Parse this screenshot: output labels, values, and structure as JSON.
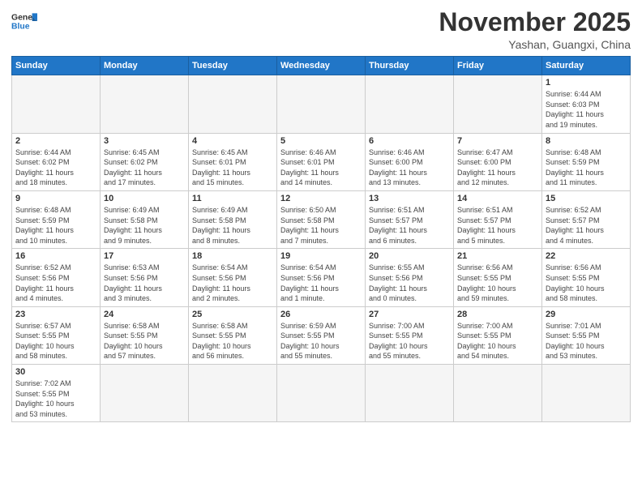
{
  "header": {
    "logo_general": "General",
    "logo_blue": "Blue",
    "month_title": "November 2025",
    "location": "Yashan, Guangxi, China"
  },
  "weekdays": [
    "Sunday",
    "Monday",
    "Tuesday",
    "Wednesday",
    "Thursday",
    "Friday",
    "Saturday"
  ],
  "weeks": [
    [
      {
        "day": "",
        "info": ""
      },
      {
        "day": "",
        "info": ""
      },
      {
        "day": "",
        "info": ""
      },
      {
        "day": "",
        "info": ""
      },
      {
        "day": "",
        "info": ""
      },
      {
        "day": "",
        "info": ""
      },
      {
        "day": "1",
        "info": "Sunrise: 6:44 AM\nSunset: 6:03 PM\nDaylight: 11 hours\nand 19 minutes."
      }
    ],
    [
      {
        "day": "2",
        "info": "Sunrise: 6:44 AM\nSunset: 6:02 PM\nDaylight: 11 hours\nand 18 minutes."
      },
      {
        "day": "3",
        "info": "Sunrise: 6:45 AM\nSunset: 6:02 PM\nDaylight: 11 hours\nand 17 minutes."
      },
      {
        "day": "4",
        "info": "Sunrise: 6:45 AM\nSunset: 6:01 PM\nDaylight: 11 hours\nand 15 minutes."
      },
      {
        "day": "5",
        "info": "Sunrise: 6:46 AM\nSunset: 6:01 PM\nDaylight: 11 hours\nand 14 minutes."
      },
      {
        "day": "6",
        "info": "Sunrise: 6:46 AM\nSunset: 6:00 PM\nDaylight: 11 hours\nand 13 minutes."
      },
      {
        "day": "7",
        "info": "Sunrise: 6:47 AM\nSunset: 6:00 PM\nDaylight: 11 hours\nand 12 minutes."
      },
      {
        "day": "8",
        "info": "Sunrise: 6:48 AM\nSunset: 5:59 PM\nDaylight: 11 hours\nand 11 minutes."
      }
    ],
    [
      {
        "day": "9",
        "info": "Sunrise: 6:48 AM\nSunset: 5:59 PM\nDaylight: 11 hours\nand 10 minutes."
      },
      {
        "day": "10",
        "info": "Sunrise: 6:49 AM\nSunset: 5:58 PM\nDaylight: 11 hours\nand 9 minutes."
      },
      {
        "day": "11",
        "info": "Sunrise: 6:49 AM\nSunset: 5:58 PM\nDaylight: 11 hours\nand 8 minutes."
      },
      {
        "day": "12",
        "info": "Sunrise: 6:50 AM\nSunset: 5:58 PM\nDaylight: 11 hours\nand 7 minutes."
      },
      {
        "day": "13",
        "info": "Sunrise: 6:51 AM\nSunset: 5:57 PM\nDaylight: 11 hours\nand 6 minutes."
      },
      {
        "day": "14",
        "info": "Sunrise: 6:51 AM\nSunset: 5:57 PM\nDaylight: 11 hours\nand 5 minutes."
      },
      {
        "day": "15",
        "info": "Sunrise: 6:52 AM\nSunset: 5:57 PM\nDaylight: 11 hours\nand 4 minutes."
      }
    ],
    [
      {
        "day": "16",
        "info": "Sunrise: 6:52 AM\nSunset: 5:56 PM\nDaylight: 11 hours\nand 4 minutes."
      },
      {
        "day": "17",
        "info": "Sunrise: 6:53 AM\nSunset: 5:56 PM\nDaylight: 11 hours\nand 3 minutes."
      },
      {
        "day": "18",
        "info": "Sunrise: 6:54 AM\nSunset: 5:56 PM\nDaylight: 11 hours\nand 2 minutes."
      },
      {
        "day": "19",
        "info": "Sunrise: 6:54 AM\nSunset: 5:56 PM\nDaylight: 11 hours\nand 1 minute."
      },
      {
        "day": "20",
        "info": "Sunrise: 6:55 AM\nSunset: 5:56 PM\nDaylight: 11 hours\nand 0 minutes."
      },
      {
        "day": "21",
        "info": "Sunrise: 6:56 AM\nSunset: 5:55 PM\nDaylight: 10 hours\nand 59 minutes."
      },
      {
        "day": "22",
        "info": "Sunrise: 6:56 AM\nSunset: 5:55 PM\nDaylight: 10 hours\nand 58 minutes."
      }
    ],
    [
      {
        "day": "23",
        "info": "Sunrise: 6:57 AM\nSunset: 5:55 PM\nDaylight: 10 hours\nand 58 minutes."
      },
      {
        "day": "24",
        "info": "Sunrise: 6:58 AM\nSunset: 5:55 PM\nDaylight: 10 hours\nand 57 minutes."
      },
      {
        "day": "25",
        "info": "Sunrise: 6:58 AM\nSunset: 5:55 PM\nDaylight: 10 hours\nand 56 minutes."
      },
      {
        "day": "26",
        "info": "Sunrise: 6:59 AM\nSunset: 5:55 PM\nDaylight: 10 hours\nand 55 minutes."
      },
      {
        "day": "27",
        "info": "Sunrise: 7:00 AM\nSunset: 5:55 PM\nDaylight: 10 hours\nand 55 minutes."
      },
      {
        "day": "28",
        "info": "Sunrise: 7:00 AM\nSunset: 5:55 PM\nDaylight: 10 hours\nand 54 minutes."
      },
      {
        "day": "29",
        "info": "Sunrise: 7:01 AM\nSunset: 5:55 PM\nDaylight: 10 hours\nand 53 minutes."
      }
    ],
    [
      {
        "day": "30",
        "info": "Sunrise: 7:02 AM\nSunset: 5:55 PM\nDaylight: 10 hours\nand 53 minutes."
      },
      {
        "day": "",
        "info": ""
      },
      {
        "day": "",
        "info": ""
      },
      {
        "day": "",
        "info": ""
      },
      {
        "day": "",
        "info": ""
      },
      {
        "day": "",
        "info": ""
      },
      {
        "day": "",
        "info": ""
      }
    ]
  ]
}
